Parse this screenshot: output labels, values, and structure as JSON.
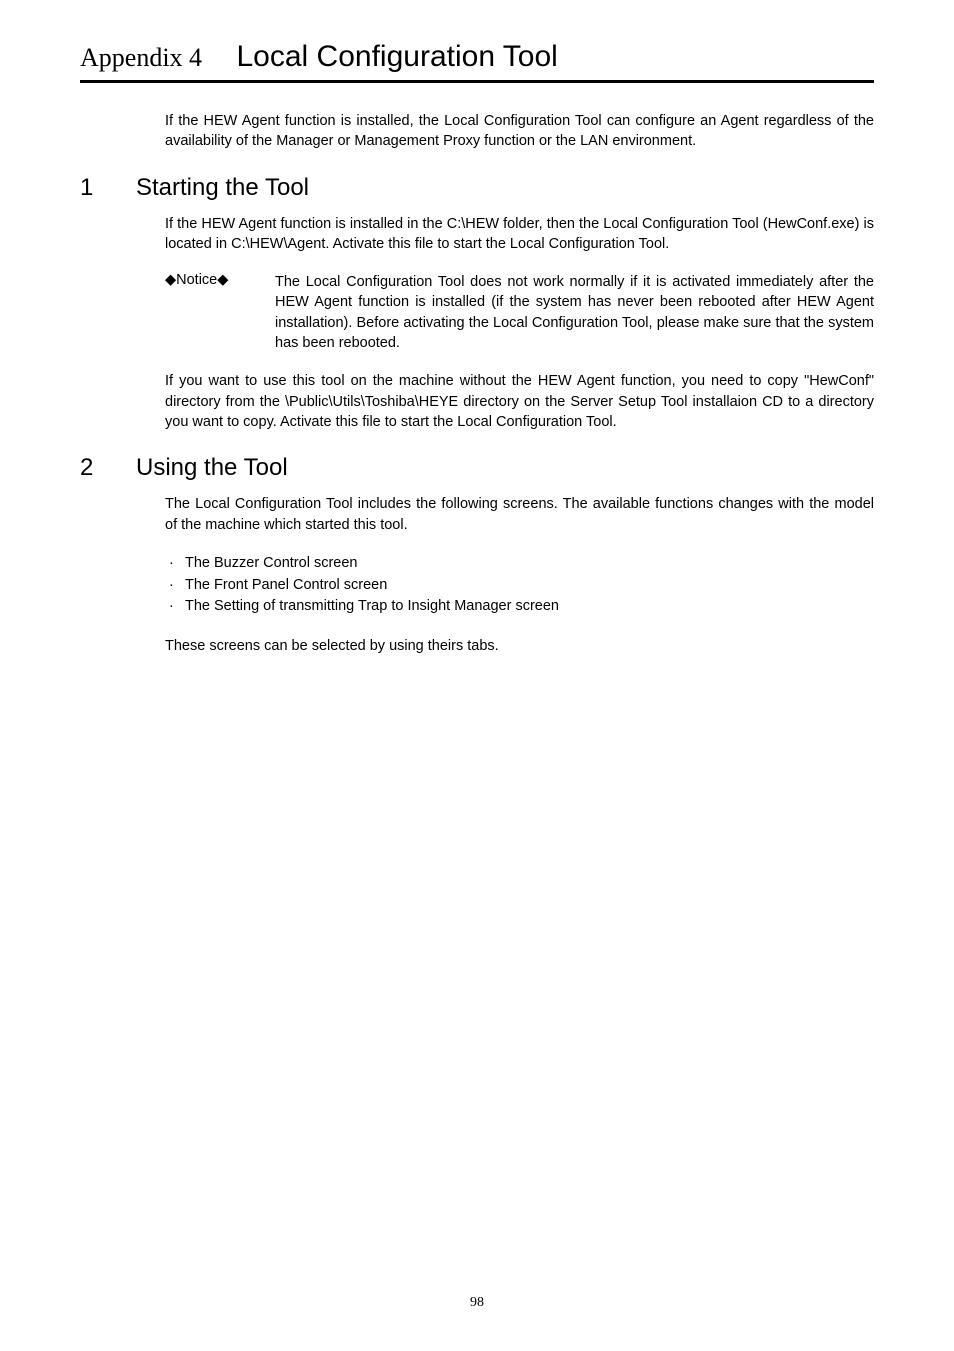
{
  "title": {
    "appendix": "Appendix 4",
    "main": "Local Configuration Tool"
  },
  "intro": "If the HEW Agent function is installed, the Local Configuration Tool can configure an Agent regardless of the availability of the Manager or Management Proxy function or the LAN environment.",
  "section1": {
    "num": "1",
    "title": "Starting the Tool",
    "para1": "If the HEW Agent function is installed in the C:\\HEW folder, then the Local Configuration Tool (HewConf.exe) is located in C:\\HEW\\Agent.   Activate this file to start the Local Configuration Tool.",
    "notice_label": "◆Notice◆",
    "notice_text": "The Local Configuration Tool does not work normally if it is activated immediately after the HEW Agent function is installed (if the system has never been rebooted after HEW Agent installation).   Before activating the Local Configuration Tool, please make sure that the system has been rebooted.",
    "para2": "If you want to use this tool on the machine without the HEW Agent function, you need to copy \"HewConf\" directory from the \\Public\\Utils\\Toshiba\\HEYE directory on the Server Setup Tool installaion CD to a directory you want to copy. Activate this file to start the Local Configuration Tool."
  },
  "section2": {
    "num": "2",
    "title": "Using the Tool",
    "para1": "The Local Configuration Tool includes the following screens.   The available functions changes with the model of the machine which started this tool.",
    "bullets": [
      "The Buzzer Control screen",
      "The Front Panel Control screen",
      "The Setting of transmitting Trap to Insight Manager screen"
    ],
    "para2": "These screens can be selected by using theirs tabs."
  },
  "page_number": "98"
}
